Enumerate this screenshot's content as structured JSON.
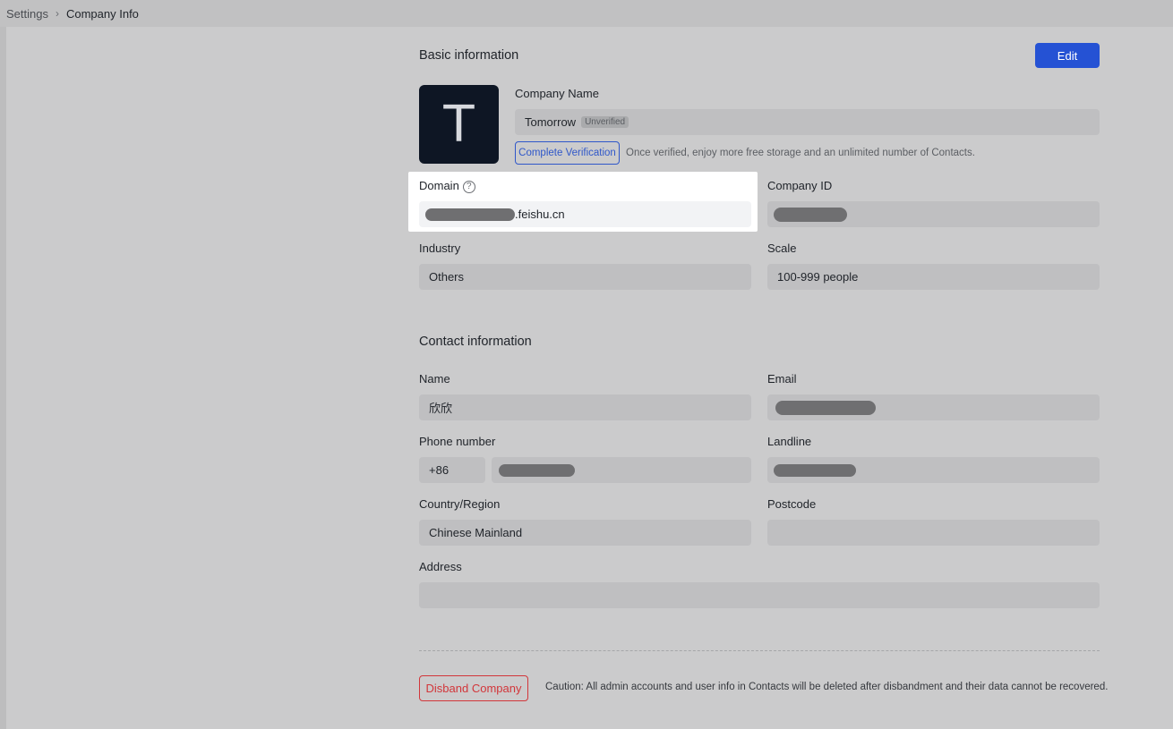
{
  "breadcrumb": {
    "root": "Settings",
    "current": "Company Info"
  },
  "basic": {
    "title": "Basic information",
    "edit_label": "Edit",
    "logo_letter": "T",
    "company_name_label": "Company Name",
    "company_name_value": "Tomorrow",
    "unverified_badge": "Unverified",
    "verify_button": "Complete Verification",
    "verify_hint": "Once verified, enjoy more free storage and an unlimited number of Contacts.",
    "domain_label": "Domain",
    "domain_suffix": ".feishu.cn",
    "company_id_label": "Company ID",
    "industry_label": "Industry",
    "industry_value": "Others",
    "scale_label": "Scale",
    "scale_value": "100-999 people"
  },
  "contact": {
    "title": "Contact information",
    "name_label": "Name",
    "name_value": "欣欣",
    "email_label": "Email",
    "phone_label": "Phone number",
    "phone_code": "+86",
    "landline_label": "Landline",
    "country_label": "Country/Region",
    "country_value": "Chinese Mainland",
    "postcode_label": "Postcode",
    "postcode_value": "",
    "address_label": "Address",
    "address_value": ""
  },
  "danger": {
    "disband_label": "Disband Company",
    "caution": "Caution: All admin accounts and user info in Contacts will be deleted after disbandment and their data cannot be recovered."
  },
  "icons": {
    "breadcrumb_separator": "chevron-right-icon",
    "domain_help": "question-circle-icon"
  },
  "colors": {
    "primary": "#2552d4",
    "danger": "#d2363a",
    "highlight": "#ffffff"
  }
}
